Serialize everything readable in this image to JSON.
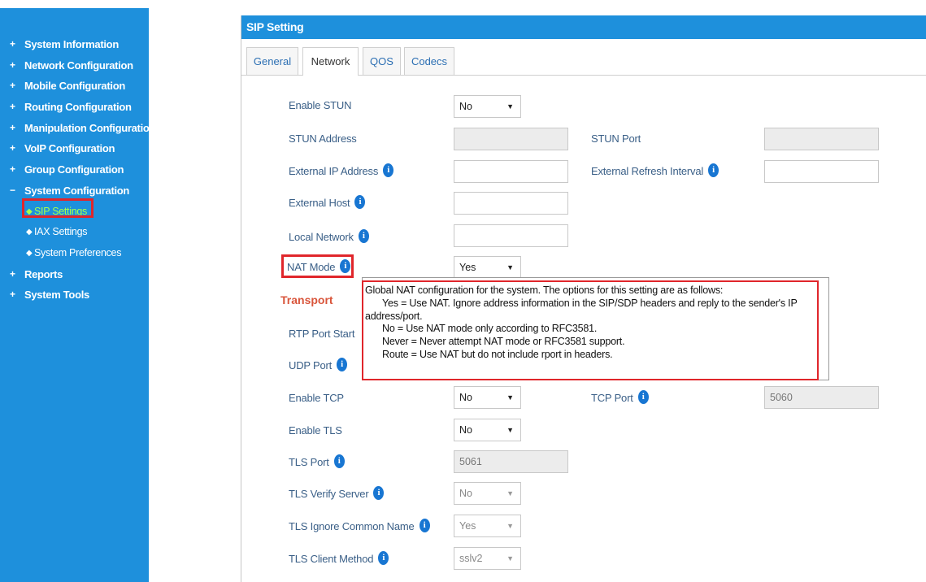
{
  "sidebar": {
    "items": [
      {
        "label": "System Information",
        "bullet": "+"
      },
      {
        "label": "Network Configuration",
        "bullet": "+"
      },
      {
        "label": "Mobile Configuration",
        "bullet": "+"
      },
      {
        "label": "Routing Configuration",
        "bullet": "+"
      },
      {
        "label": "Manipulation Configuration",
        "bullet": "+"
      },
      {
        "label": "VoIP Configuration",
        "bullet": "+"
      },
      {
        "label": "Group Configuration",
        "bullet": "+"
      },
      {
        "label": "System Configuration",
        "bullet": "−"
      }
    ],
    "sub_items": [
      {
        "label": "SIP Settings",
        "active": true
      },
      {
        "label": "IAX Settings"
      },
      {
        "label": "System Preferences"
      }
    ],
    "bottom_items": [
      {
        "label": "Reports",
        "bullet": "+"
      },
      {
        "label": "System Tools",
        "bullet": "+"
      }
    ]
  },
  "panel": {
    "title": "SIP Setting",
    "tabs": [
      {
        "label": "General"
      },
      {
        "label": "Network",
        "active": true
      },
      {
        "label": "QOS"
      },
      {
        "label": "Codecs"
      }
    ]
  },
  "form": {
    "enable_stun": {
      "label": "Enable STUN",
      "value": "No"
    },
    "stun_address": {
      "label": "STUN Address",
      "value": ""
    },
    "stun_port": {
      "label": "STUN Port",
      "value": ""
    },
    "external_ip": {
      "label": "External IP Address",
      "value": ""
    },
    "external_refresh": {
      "label": "External Refresh Interval",
      "value": ""
    },
    "external_host": {
      "label": "External Host",
      "value": ""
    },
    "local_network": {
      "label": "Local Network",
      "value": ""
    },
    "nat_mode": {
      "label": "NAT Mode",
      "value": "Yes"
    },
    "transport_heading": "Transport",
    "rtp_port_start": {
      "label": "RTP Port Start"
    },
    "udp_port": {
      "label": "UDP Port"
    },
    "enable_tcp": {
      "label": "Enable TCP",
      "value": "No"
    },
    "tcp_port": {
      "label": "TCP Port",
      "value": "5060"
    },
    "enable_tls": {
      "label": "Enable TLS",
      "value": "No"
    },
    "tls_port": {
      "label": "TLS Port",
      "value": "5061"
    },
    "tls_verify_server": {
      "label": "TLS Verify Server",
      "value": "No"
    },
    "tls_ignore_common_name": {
      "label": "TLS Ignore Common Name",
      "value": "Yes"
    },
    "tls_client_method": {
      "label": "TLS Client Method",
      "value": "sslv2"
    }
  },
  "tooltip": {
    "lines": [
      "Global NAT configuration for the system. The options for this setting are as follows:",
      "Yes = Use NAT. Ignore address information in the SIP/SDP headers and reply to the sender's IP",
      "address/port.",
      "No = Use NAT mode only according to RFC3581.",
      "Never = Never attempt NAT mode or RFC3581 support.",
      "Route = Use NAT but do not include rport in headers."
    ]
  },
  "icons": {
    "info": "info-icon",
    "dropdown": "caret-down-icon"
  },
  "colors": {
    "accent": "#1e90dc",
    "highlight": "#e0262b",
    "section": "#d9553b",
    "active_nav": "#a6ff4d"
  }
}
